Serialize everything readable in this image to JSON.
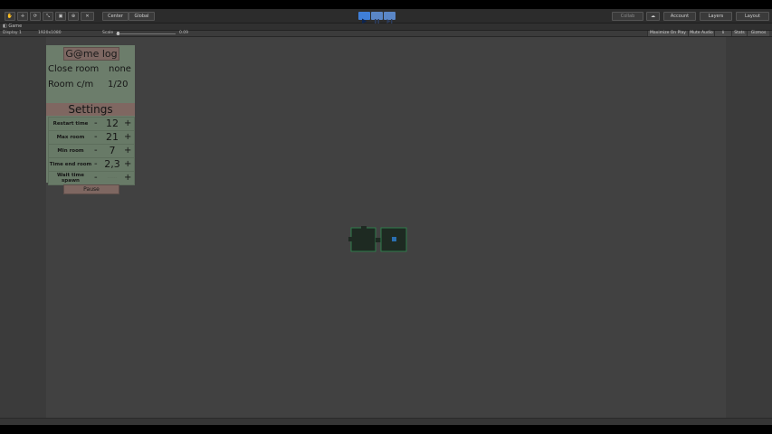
{
  "toolbar": {
    "pivot_center": "Center",
    "pivot_global": "Global",
    "collab": "Collab",
    "account": "Account",
    "layers": "Layers",
    "layout": "Layout"
  },
  "tab": {
    "label": "Game"
  },
  "gamebar": {
    "display": "Display 1",
    "resolution": "1920x1080",
    "scale_label": "Scale",
    "scale_value": "0.09",
    "maximize": "Maximize On Play",
    "mute": "Mute Audio",
    "stats": "Stats",
    "gizmos": "Gizmos"
  },
  "game_log": {
    "title": "G@me log",
    "close_room_label": "Close room",
    "close_room_value": "none",
    "room_cm_label": "Room c/m",
    "room_cm_value": "1/20"
  },
  "settings": {
    "title": "Settings",
    "rows": [
      {
        "label": "Restart time",
        "value": "12"
      },
      {
        "label": "Max room",
        "value": "21"
      },
      {
        "label": "Min room",
        "value": "7"
      },
      {
        "label": "Time end room",
        "value": "2,3"
      },
      {
        "label": "Wait time spawn",
        "value": "------"
      }
    ],
    "minus": "-",
    "plus": "+",
    "pause": "Pause"
  },
  "colors": {
    "panel": "#6c7d6b",
    "accent_rose": "#7f6761",
    "play_active": "#3f7fd8"
  }
}
